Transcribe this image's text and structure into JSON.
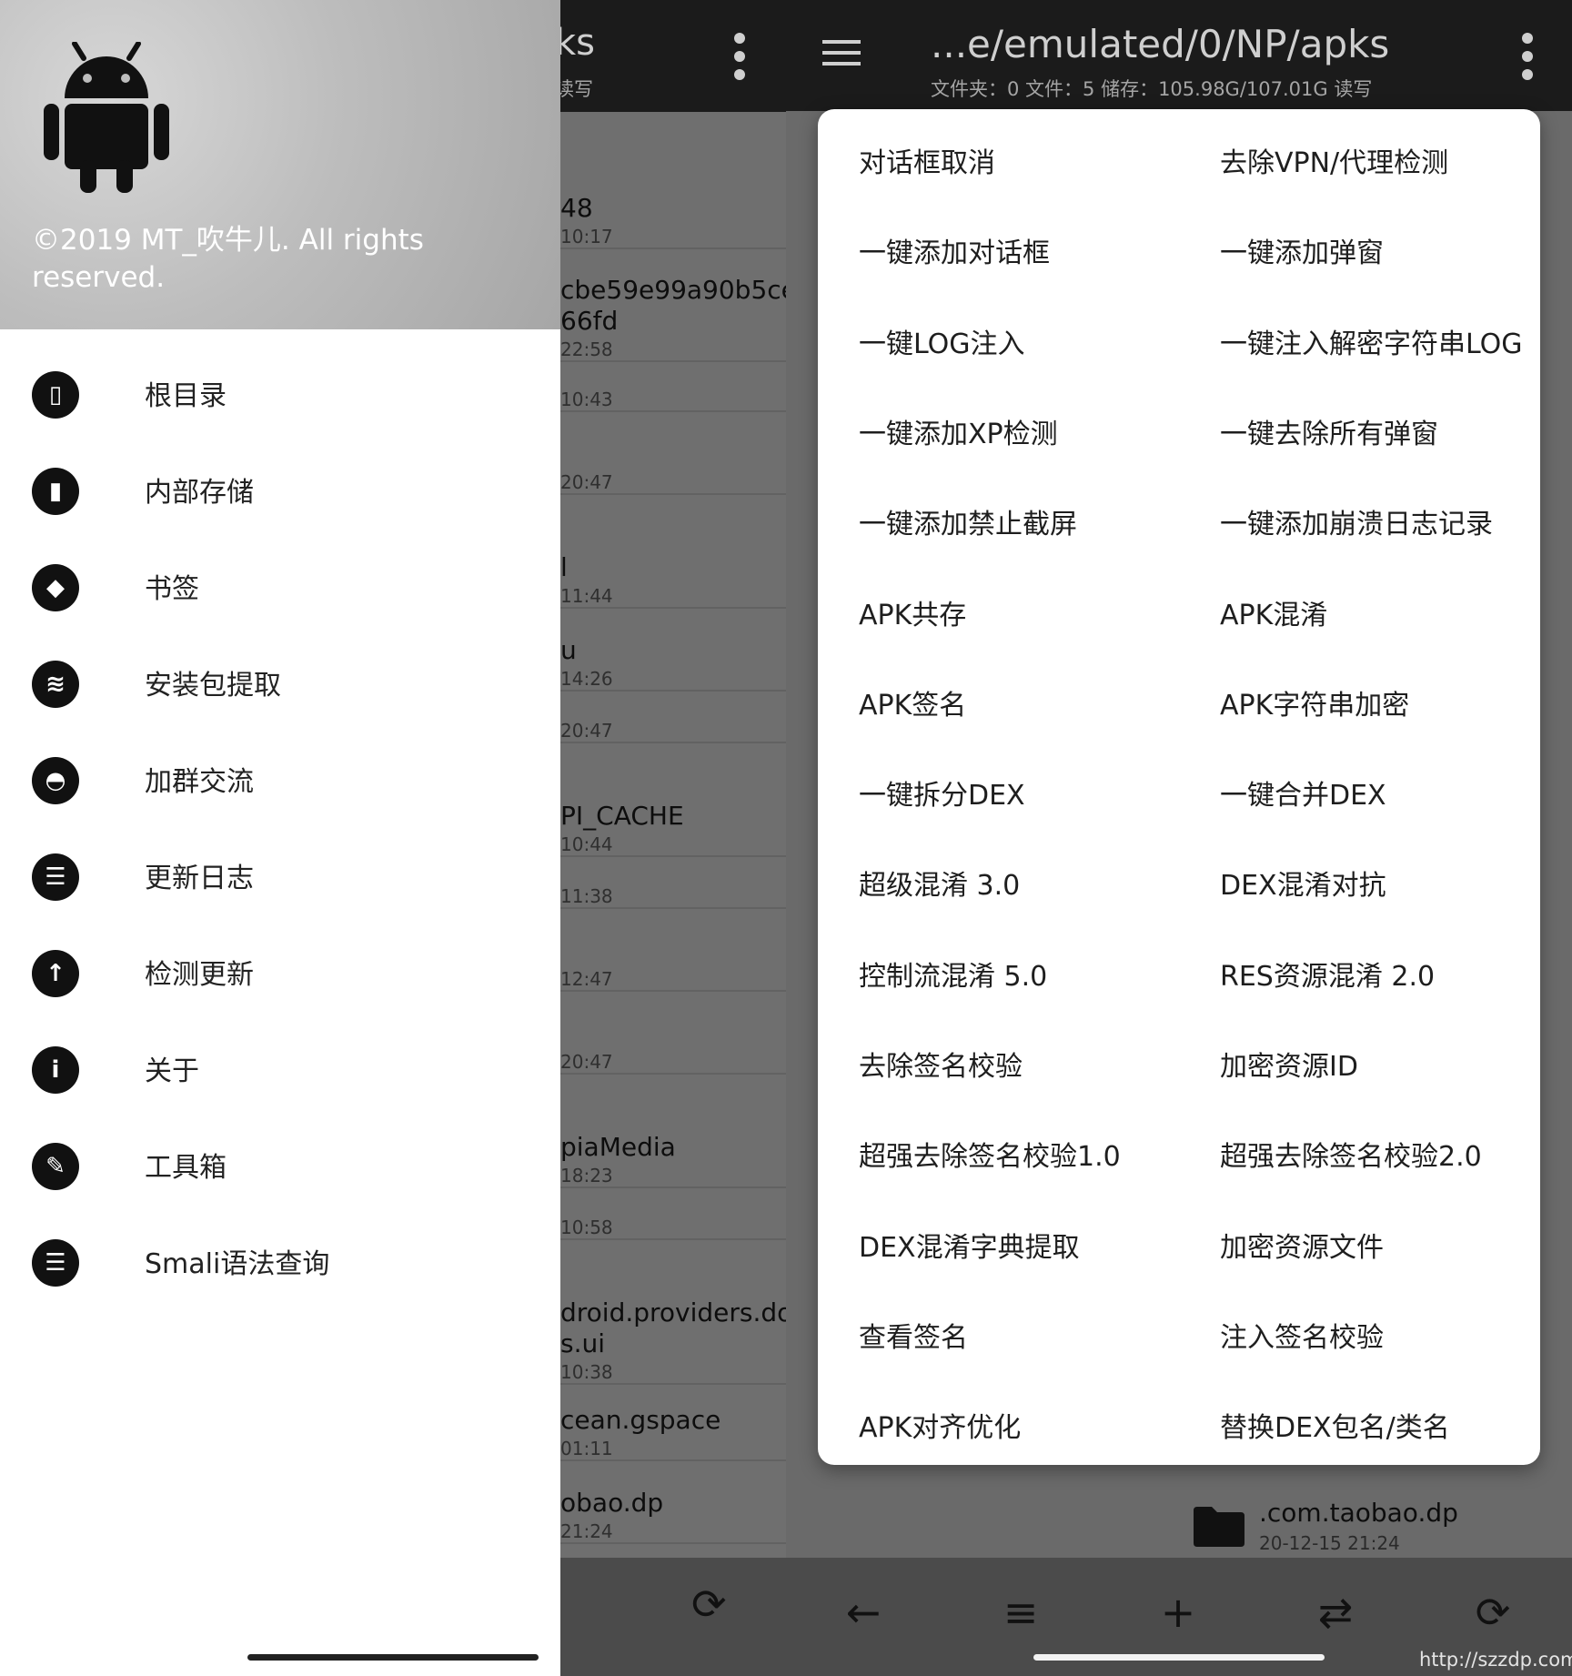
{
  "left_screen": {
    "background_list": {
      "title_fragment": "ks",
      "subtitle_fragment": "读写",
      "rows": [
        {
          "name": "48",
          "time": "10:17"
        },
        {
          "name": "cbe59e99a90b5ce",
          "name2": "66fd",
          "time": "22:58"
        },
        {
          "name": "",
          "time": "10:43"
        },
        {
          "name": "",
          "time": "20:47"
        },
        {
          "name": "l",
          "time": "11:44"
        },
        {
          "name": "u",
          "time": "14:26"
        },
        {
          "name": "",
          "time": "20:47"
        },
        {
          "name": "PI_CACHE",
          "time": "10:44"
        },
        {
          "name": "",
          "time": "11:38"
        },
        {
          "name": "",
          "time": "12:47"
        },
        {
          "name": "",
          "time": "20:47"
        },
        {
          "name": "piaMedia",
          "time": "18:23"
        },
        {
          "name": "",
          "time": "10:58"
        },
        {
          "name": "droid.providers.do",
          "name2": "s.ui",
          "time": "10:38"
        },
        {
          "name": "cean.gspace",
          "time": "01:11"
        },
        {
          "name": "obao.dp",
          "time": "21:24"
        }
      ]
    },
    "drawer": {
      "copyright": "©2019 MT_吹牛儿. All rights reserved.",
      "items": [
        {
          "label": "根目录",
          "icon": "phone-icon"
        },
        {
          "label": "内部存储",
          "icon": "sd-card-icon"
        },
        {
          "label": "书签",
          "icon": "bookmark-icon"
        },
        {
          "label": "安装包提取",
          "icon": "layers-icon"
        },
        {
          "label": "加群交流",
          "icon": "qq-penguin-icon"
        },
        {
          "label": "更新日志",
          "icon": "clipboard-icon"
        },
        {
          "label": "检测更新",
          "icon": "arrow-up-icon"
        },
        {
          "label": "关于",
          "icon": "info-icon"
        },
        {
          "label": "工具箱",
          "icon": "wrench-icon"
        },
        {
          "label": "Smali语法查询",
          "icon": "clipboard-icon"
        }
      ]
    }
  },
  "right_screen": {
    "header": {
      "path": "...e/emulated/0/NP/apks",
      "status": "文件夹：0   文件：5 储存：105.98G/107.01G    读写"
    },
    "visible_folder": {
      "name": ".com.taobao.dp",
      "time": "20-12-15 21:24"
    },
    "options": [
      [
        "对话框取消",
        "去除VPN/代理检测"
      ],
      [
        "一键添加对话框",
        "一键添加弹窗"
      ],
      [
        "一键LOG注入",
        "一键注入解密字符串LOG"
      ],
      [
        "一键添加XP检测",
        "一键去除所有弹窗"
      ],
      [
        "一键添加禁止截屏",
        "一键添加崩溃日志记录"
      ],
      [
        "APK共存",
        "APK混淆"
      ],
      [
        "APK签名",
        "APK字符串加密"
      ],
      [
        "一键拆分DEX",
        "一键合并DEX"
      ],
      [
        "超级混淆 3.0",
        "DEX混淆对抗"
      ],
      [
        "控制流混淆 5.0",
        "RES资源混淆 2.0"
      ],
      [
        "去除签名校验",
        "加密资源ID"
      ],
      [
        "超强去除签名校验1.0",
        "超强去除签名校验2.0"
      ],
      [
        "DEX混淆字典提取",
        "加密资源文件"
      ],
      [
        "查看签名",
        "注入签名校验"
      ],
      [
        "APK对齐优化",
        "替换DEX包名/类名"
      ]
    ]
  },
  "watermark": "http://szzdp.com",
  "colors": {
    "header_dark": "#1b1b1b",
    "drawer_bg": "#ffffff",
    "dim_overlay": "#6f6f6f",
    "popup_bg": "#ffffff"
  }
}
